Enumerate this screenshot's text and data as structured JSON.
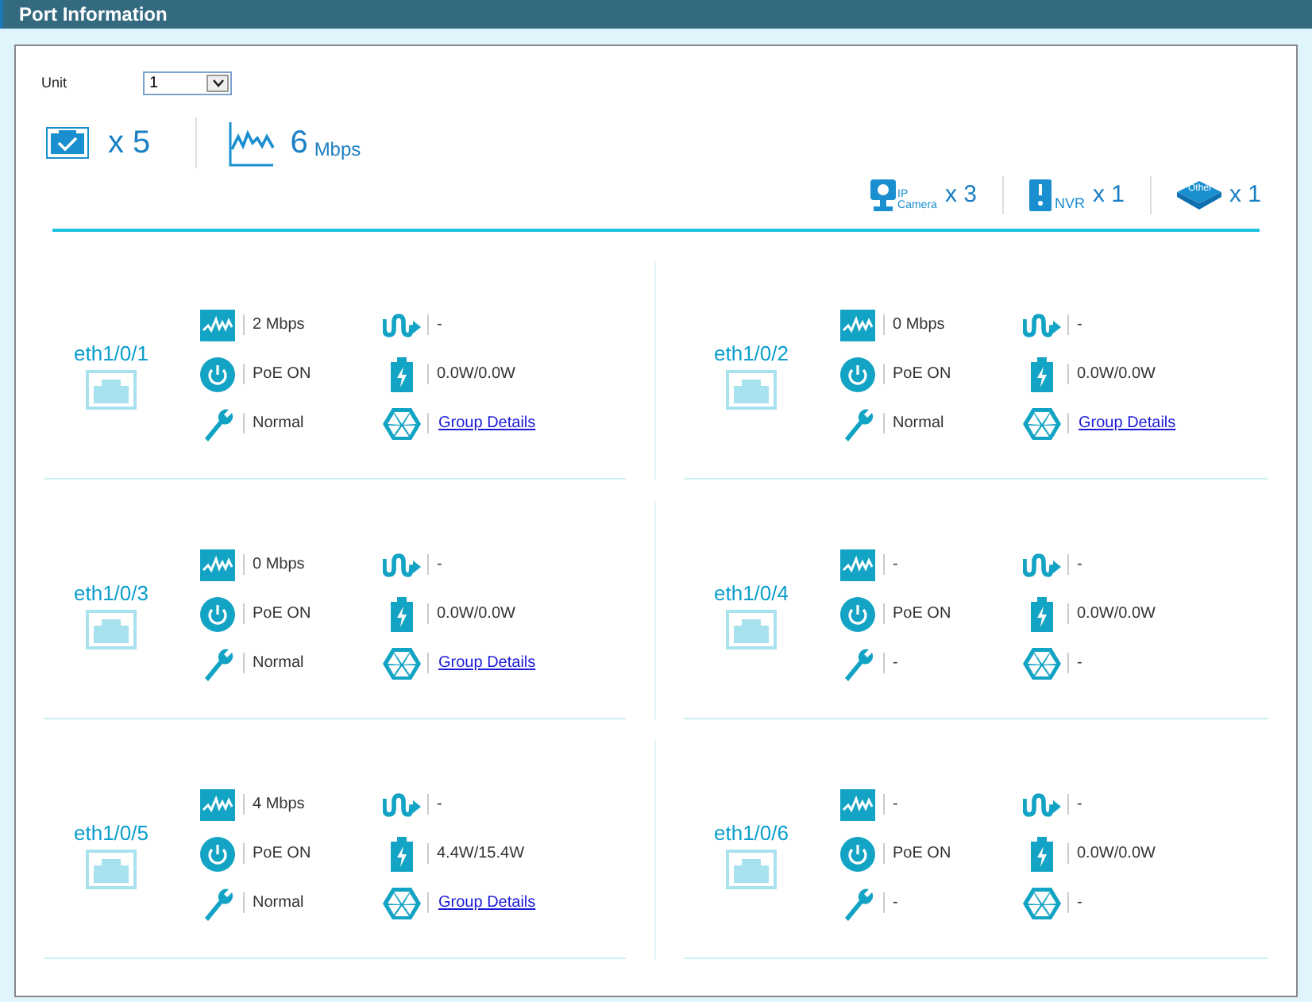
{
  "header": {
    "title": "Port Information"
  },
  "unit": {
    "label": "Unit",
    "value": "1"
  },
  "summary": {
    "ports": "x 5",
    "traffic_value": "6",
    "traffic_unit": "Mbps"
  },
  "devices": [
    {
      "kind": "camera",
      "label_top": "IP",
      "label_bottom": "Camera",
      "count": "x 3"
    },
    {
      "kind": "nvr",
      "label": "NVR",
      "count": "x 1"
    },
    {
      "kind": "other",
      "label": "Other",
      "count": "x 1"
    }
  ],
  "ports": [
    {
      "name": "eth1/0/1",
      "traffic": "2 Mbps",
      "poe": "PoE ON",
      "status": "Normal",
      "flow": "-",
      "power": "0.0W/0.0W",
      "group": {
        "kind": "link",
        "text": "Group Details"
      }
    },
    {
      "name": "eth1/0/2",
      "traffic": "0 Mbps",
      "poe": "PoE ON",
      "status": "Normal",
      "flow": "-",
      "power": "0.0W/0.0W",
      "group": {
        "kind": "link",
        "text": "Group Details"
      }
    },
    {
      "name": "eth1/0/3",
      "traffic": "0 Mbps",
      "poe": "PoE ON",
      "status": "Normal",
      "flow": "-",
      "power": "0.0W/0.0W",
      "group": {
        "kind": "link",
        "text": "Group Details"
      }
    },
    {
      "name": "eth1/0/4",
      "traffic": "-",
      "poe": "PoE ON",
      "status": "-",
      "flow": "-",
      "power": "0.0W/0.0W",
      "group": {
        "kind": "text",
        "text": "-"
      }
    },
    {
      "name": "eth1/0/5",
      "traffic": "4 Mbps",
      "poe": "PoE ON",
      "status": "Normal",
      "flow": "-",
      "power": "4.4W/15.4W",
      "group": {
        "kind": "link",
        "text": "Group Details"
      }
    },
    {
      "name": "eth1/0/6",
      "traffic": "-",
      "poe": "PoE ON",
      "status": "-",
      "flow": "-",
      "power": "0.0W/0.0W",
      "group": {
        "kind": "text",
        "text": "-"
      }
    }
  ]
}
